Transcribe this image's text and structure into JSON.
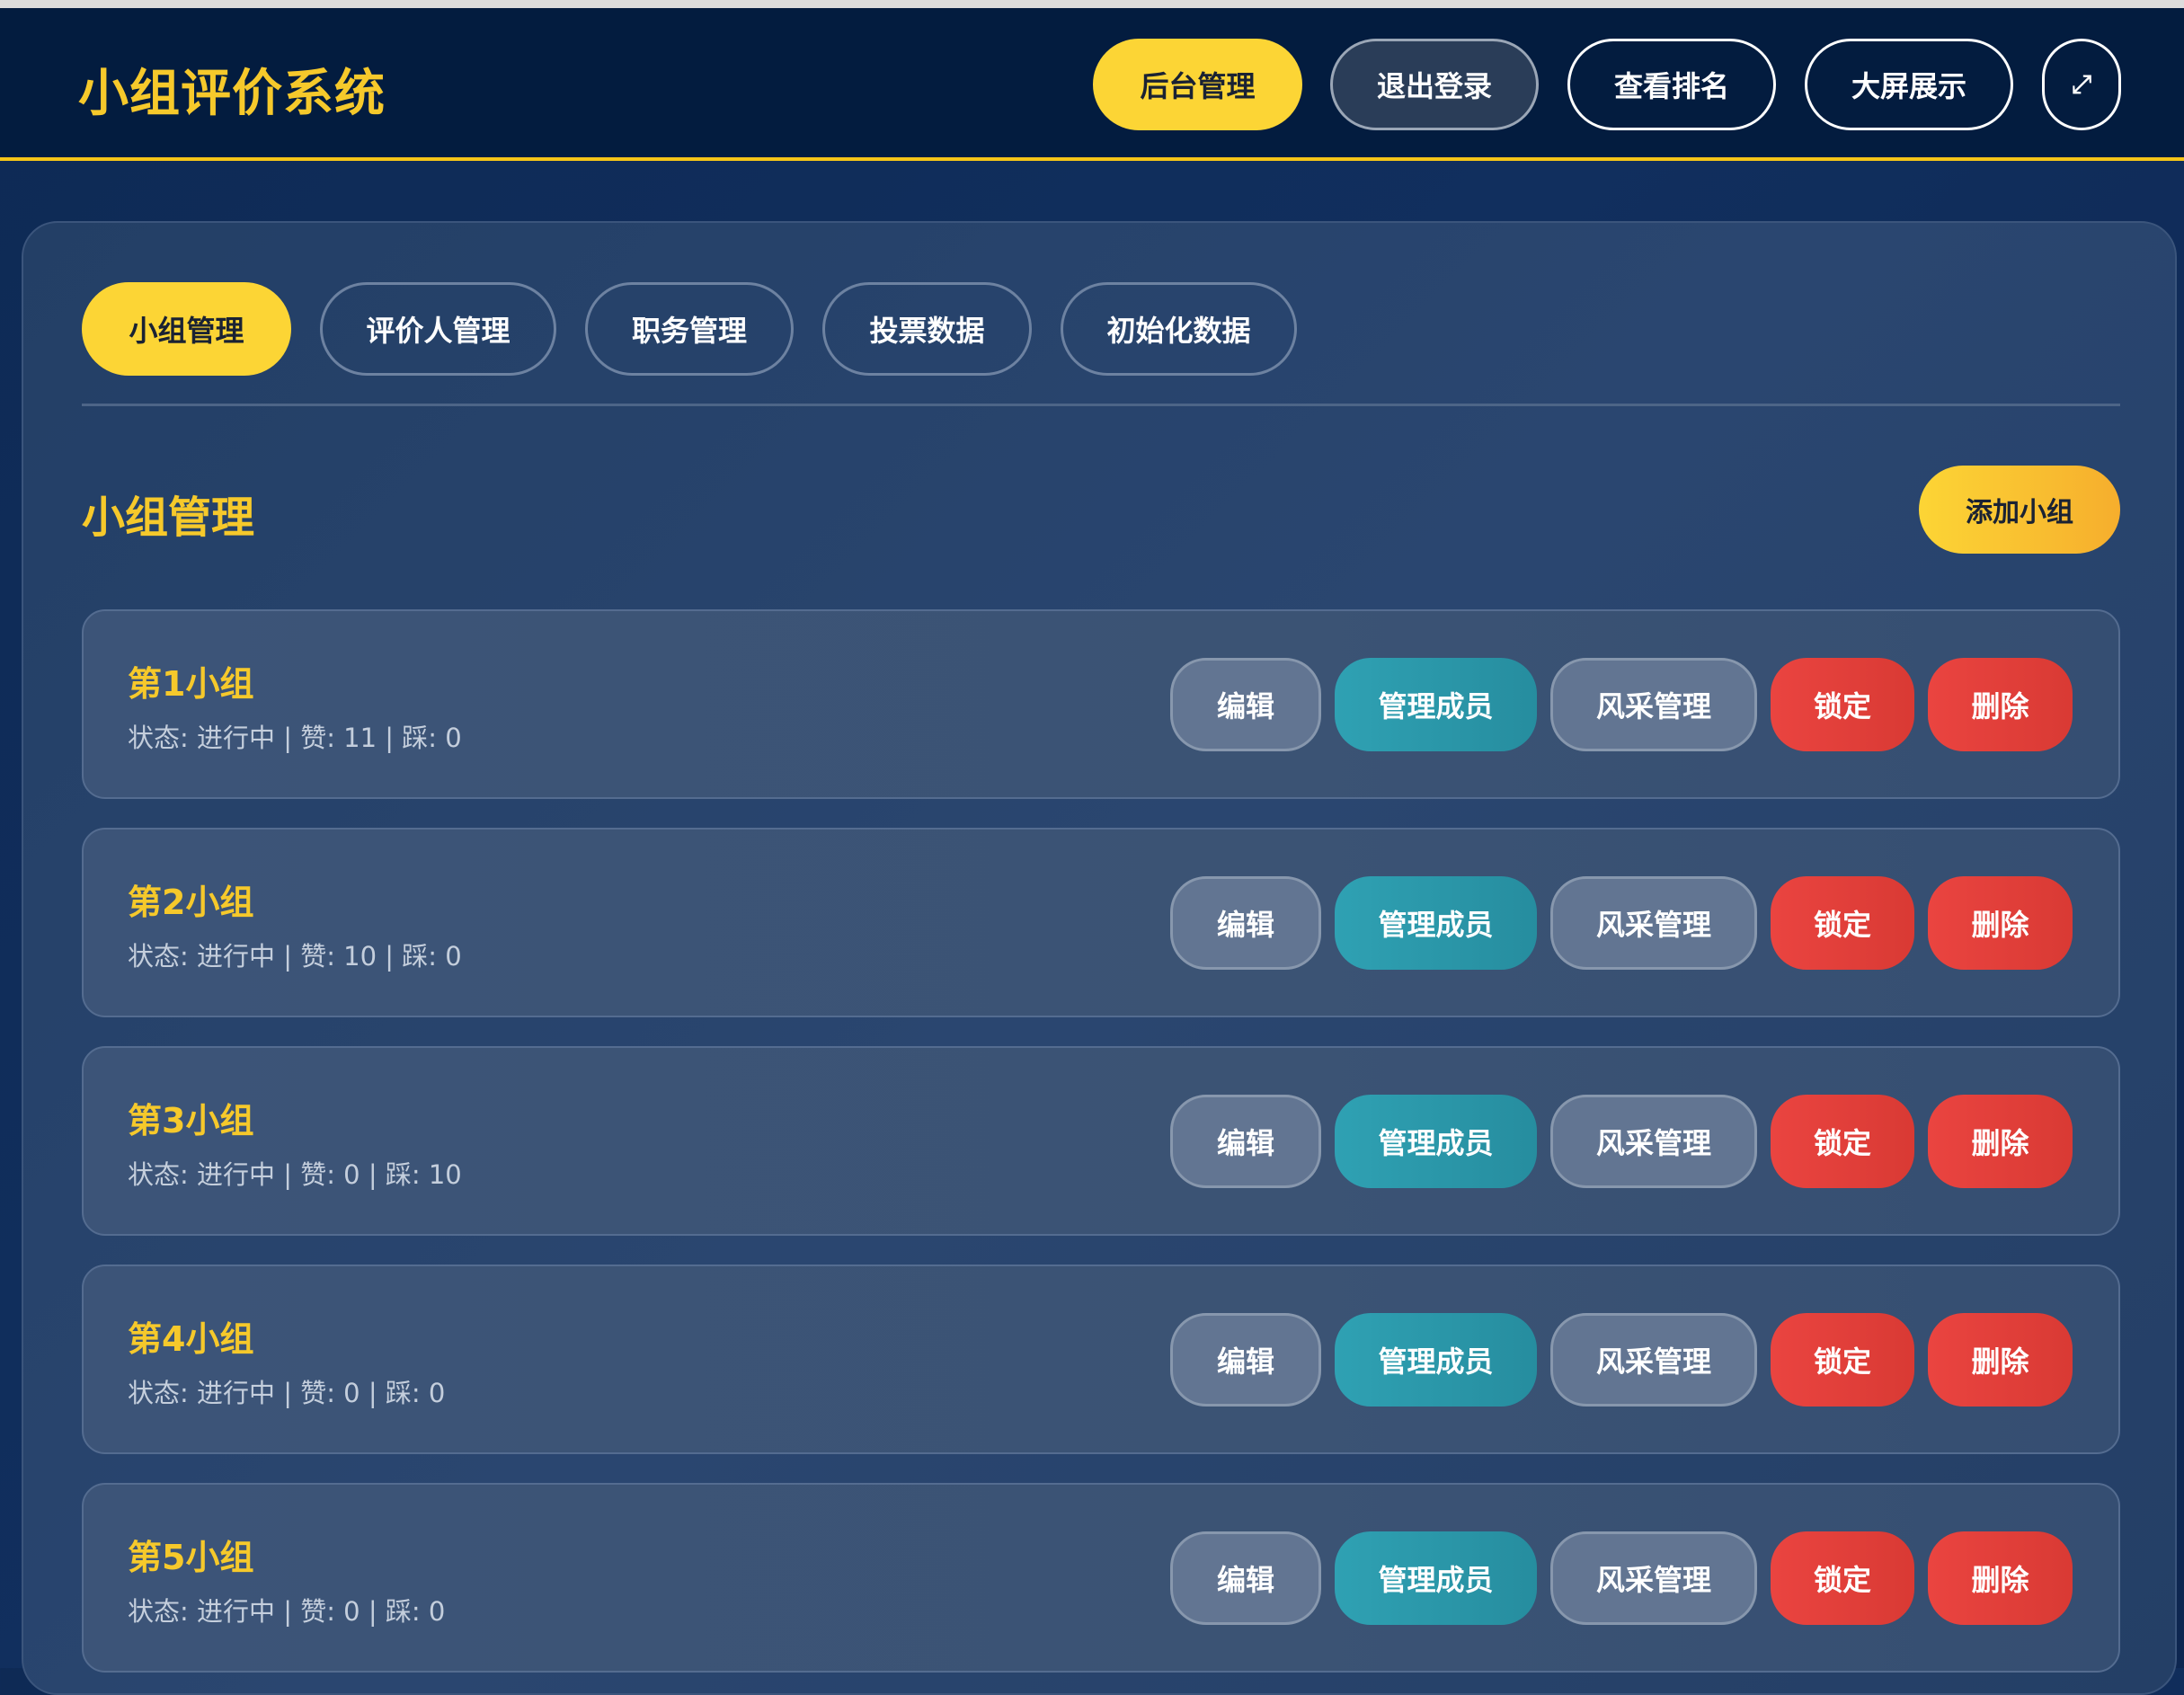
{
  "header": {
    "title": "小组评价系统",
    "buttons": {
      "admin": "后台管理",
      "logout": "退出登录",
      "ranking": "查看排名",
      "bigscreen": "大屏展示",
      "fullscreen": "⤢"
    }
  },
  "tabs": [
    "小组管理",
    "评价人管理",
    "职务管理",
    "投票数据",
    "初始化数据"
  ],
  "section": {
    "title": "小组管理",
    "add_button": "添加小组"
  },
  "row_actions": {
    "edit": "编辑",
    "members": "管理成员",
    "style": "风采管理",
    "lock": "锁定",
    "delete": "删除"
  },
  "groups": [
    {
      "name": "第1小组",
      "status": "状态: 进行中 | 赞: 11 | 踩: 0"
    },
    {
      "name": "第2小组",
      "status": "状态: 进行中 | 赞: 10 | 踩: 0"
    },
    {
      "name": "第3小组",
      "status": "状态: 进行中 | 赞: 0 | 踩: 10"
    },
    {
      "name": "第4小组",
      "status": "状态: 进行中 | 赞: 0 | 踩: 0"
    },
    {
      "name": "第5小组",
      "status": "状态: 进行中 | 赞: 0 | 踩: 0"
    }
  ],
  "colors": {
    "accent": "#fcd535",
    "title": "#f6c92b",
    "members": "#2fa1b3",
    "danger": "#ea4440"
  }
}
